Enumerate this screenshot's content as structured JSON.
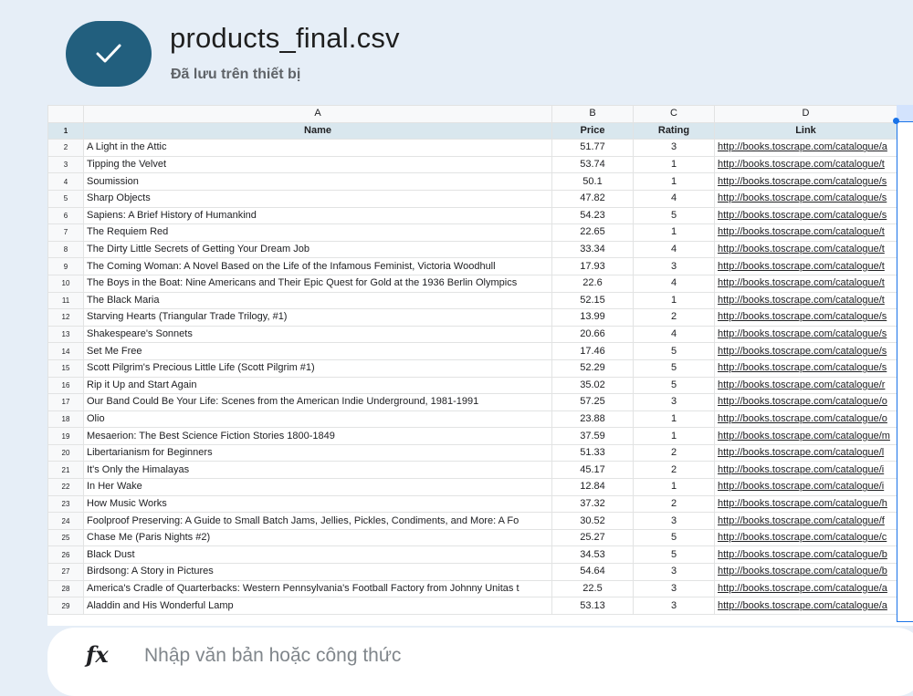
{
  "header": {
    "file_name": "products_final.csv",
    "save_status": "Đã lưu trên thiết bị"
  },
  "grid": {
    "column_letters": [
      "A",
      "B",
      "C",
      "D"
    ],
    "header_row": {
      "row_num": "1",
      "cells": [
        "Name",
        "Price",
        "Rating",
        "Link"
      ]
    },
    "rows": [
      {
        "n": "2",
        "name": "A Light in the Attic",
        "price": "51.77",
        "rating": "3",
        "link": "http://books.toscrape.com/catalogue/a"
      },
      {
        "n": "3",
        "name": "Tipping the Velvet",
        "price": "53.74",
        "rating": "1",
        "link": "http://books.toscrape.com/catalogue/t"
      },
      {
        "n": "4",
        "name": "Soumission",
        "price": "50.1",
        "rating": "1",
        "link": "http://books.toscrape.com/catalogue/s"
      },
      {
        "n": "5",
        "name": "Sharp Objects",
        "price": "47.82",
        "rating": "4",
        "link": "http://books.toscrape.com/catalogue/s"
      },
      {
        "n": "6",
        "name": "Sapiens: A Brief History of Humankind",
        "price": "54.23",
        "rating": "5",
        "link": "http://books.toscrape.com/catalogue/s"
      },
      {
        "n": "7",
        "name": "The Requiem Red",
        "price": "22.65",
        "rating": "1",
        "link": "http://books.toscrape.com/catalogue/t"
      },
      {
        "n": "8",
        "name": "The Dirty Little Secrets of Getting Your Dream Job",
        "price": "33.34",
        "rating": "4",
        "link": "http://books.toscrape.com/catalogue/t"
      },
      {
        "n": "9",
        "name": "The Coming Woman: A Novel Based on the Life of the Infamous Feminist, Victoria Woodhull",
        "price": "17.93",
        "rating": "3",
        "link": "http://books.toscrape.com/catalogue/t"
      },
      {
        "n": "10",
        "name": "The Boys in the Boat: Nine Americans and Their Epic Quest for Gold at the 1936 Berlin Olympics",
        "price": "22.6",
        "rating": "4",
        "link": "http://books.toscrape.com/catalogue/t"
      },
      {
        "n": "11",
        "name": "The Black Maria",
        "price": "52.15",
        "rating": "1",
        "link": "http://books.toscrape.com/catalogue/t"
      },
      {
        "n": "12",
        "name": "Starving Hearts (Triangular Trade Trilogy, #1)",
        "price": "13.99",
        "rating": "2",
        "link": "http://books.toscrape.com/catalogue/s"
      },
      {
        "n": "13",
        "name": "Shakespeare's Sonnets",
        "price": "20.66",
        "rating": "4",
        "link": "http://books.toscrape.com/catalogue/s"
      },
      {
        "n": "14",
        "name": "Set Me Free",
        "price": "17.46",
        "rating": "5",
        "link": "http://books.toscrape.com/catalogue/s"
      },
      {
        "n": "15",
        "name": "Scott Pilgrim's Precious Little Life (Scott Pilgrim #1)",
        "price": "52.29",
        "rating": "5",
        "link": "http://books.toscrape.com/catalogue/s"
      },
      {
        "n": "16",
        "name": "Rip it Up and Start Again",
        "price": "35.02",
        "rating": "5",
        "link": "http://books.toscrape.com/catalogue/r"
      },
      {
        "n": "17",
        "name": "Our Band Could Be Your Life: Scenes from the American Indie Underground, 1981-1991",
        "price": "57.25",
        "rating": "3",
        "link": "http://books.toscrape.com/catalogue/o"
      },
      {
        "n": "18",
        "name": "Olio",
        "price": "23.88",
        "rating": "1",
        "link": "http://books.toscrape.com/catalogue/o"
      },
      {
        "n": "19",
        "name": "Mesaerion: The Best Science Fiction Stories 1800-1849",
        "price": "37.59",
        "rating": "1",
        "link": "http://books.toscrape.com/catalogue/m"
      },
      {
        "n": "20",
        "name": "Libertarianism for Beginners",
        "price": "51.33",
        "rating": "2",
        "link": "http://books.toscrape.com/catalogue/l"
      },
      {
        "n": "21",
        "name": "It's Only the Himalayas",
        "price": "45.17",
        "rating": "2",
        "link": "http://books.toscrape.com/catalogue/i"
      },
      {
        "n": "22",
        "name": "In Her Wake",
        "price": "12.84",
        "rating": "1",
        "link": "http://books.toscrape.com/catalogue/i"
      },
      {
        "n": "23",
        "name": "How Music Works",
        "price": "37.32",
        "rating": "2",
        "link": "http://books.toscrape.com/catalogue/h"
      },
      {
        "n": "24",
        "name": "Foolproof Preserving: A Guide to Small Batch Jams, Jellies, Pickles, Condiments, and More: A Fo",
        "price": "30.52",
        "rating": "3",
        "link": "http://books.toscrape.com/catalogue/f"
      },
      {
        "n": "25",
        "name": "Chase Me (Paris Nights #2)",
        "price": "25.27",
        "rating": "5",
        "link": "http://books.toscrape.com/catalogue/c"
      },
      {
        "n": "26",
        "name": "Black Dust",
        "price": "34.53",
        "rating": "5",
        "link": "http://books.toscrape.com/catalogue/b"
      },
      {
        "n": "27",
        "name": "Birdsong: A Story in Pictures",
        "price": "54.64",
        "rating": "3",
        "link": "http://books.toscrape.com/catalogue/b"
      },
      {
        "n": "28",
        "name": "America's Cradle of Quarterbacks: Western Pennsylvania's Football Factory from Johnny Unitas t",
        "price": "22.5",
        "rating": "3",
        "link": "http://books.toscrape.com/catalogue/a"
      },
      {
        "n": "29",
        "name": "Aladdin and His Wonderful Lamp",
        "price": "53.13",
        "rating": "3",
        "link": "http://books.toscrape.com/catalogue/a"
      }
    ]
  },
  "formula_bar": {
    "icon": "fx-icon",
    "placeholder": "Nhập văn bản hoặc công thức"
  },
  "colors": {
    "badge": "#225f7e",
    "header_fill": "#d9e7ee",
    "link": "#1155cc",
    "selection": "#1a73e8"
  }
}
